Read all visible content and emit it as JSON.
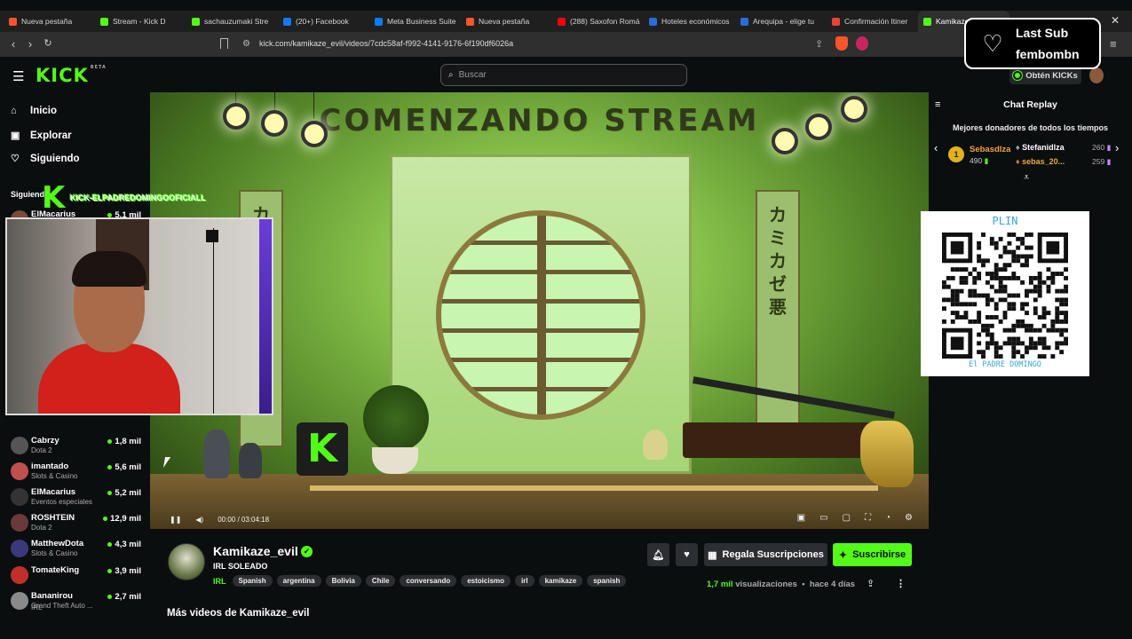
{
  "browser": {
    "tabs": [
      {
        "title": "Nueva pestaña",
        "color": "#fb542b"
      },
      {
        "title": "Stream - Kick D",
        "color": "#53fc18"
      },
      {
        "title": "sachauzumaki Stre",
        "color": "#53fc18"
      },
      {
        "title": "(20+) Facebook",
        "color": "#1877f2"
      },
      {
        "title": "Meta Business Suite",
        "color": "#0a7cff"
      },
      {
        "title": "Nueva pestaña",
        "color": "#fb542b"
      },
      {
        "title": "(288) Saxofon Romá",
        "color": "#ff0000"
      },
      {
        "title": "Hoteles económicos",
        "color": "#2a6dd9"
      },
      {
        "title": "Arequipa - elige tu",
        "color": "#2a6dd9"
      },
      {
        "title": "Confirmación Itiner",
        "color": "#ea4335"
      },
      {
        "title": "Kamikaze",
        "color": "#53fc18"
      }
    ],
    "url": "kick.com/kamikaze_evil/videos/7cdc58af-f992-4141-9176-6f190df6026a"
  },
  "header": {
    "logo": "KICK",
    "logo_badge": "BETA",
    "search_placeholder": "Buscar",
    "kicks_button": "Obtén KICKs"
  },
  "overlay": {
    "last_sub_label": "Last Sub",
    "last_sub_name": "fembombn",
    "webcam_name": "KICK-ELPADREDOMINGOOFICIALL"
  },
  "sidebar": {
    "nav": [
      {
        "label": "Inicio",
        "icon": "home-icon"
      },
      {
        "label": "Explorar",
        "icon": "compass-icon"
      },
      {
        "label": "Siguiendo",
        "icon": "heart-icon"
      }
    ],
    "section_title": "Siguiendo",
    "channels": [
      {
        "name": "ElMacarius",
        "category": "",
        "viewers": "5,1 mil"
      },
      {
        "name": "Cabrzy",
        "category": "Dota 2",
        "viewers": "1,8 mil"
      },
      {
        "name": "imantado",
        "category": "Slots & Casino",
        "viewers": "5,6 mil"
      },
      {
        "name": "ElMacarius",
        "category": "Eventos especiales",
        "viewers": "5,2 mil"
      },
      {
        "name": "ROSHTEIN",
        "category": "Dota 2",
        "viewers": "12,9 mil"
      },
      {
        "name": "MatthewDota",
        "category": "Slots & Casino",
        "viewers": "4,3 mil"
      },
      {
        "name": "TomateKing",
        "category": "",
        "viewers": "3,9 mil"
      },
      {
        "name": "Bananirou",
        "category": "Grand Theft Auto ...",
        "viewers": "2,7 mil"
      }
    ],
    "last_category": "IRL"
  },
  "video": {
    "scene_title": "COMENZANDO STREAM",
    "scroll_left": [
      "カ",
      "ミ",
      "カ",
      "ゼ",
      "悪"
    ],
    "scroll_right": [
      "カ",
      "ミ",
      "カ",
      "ゼ",
      "悪"
    ],
    "time": "00:00 / 03:04:18"
  },
  "chat": {
    "title": "Chat Replay",
    "donors_title": "Mejores donadores de todos los tiempos",
    "top_donor": {
      "rank": "1",
      "name": "Sebasdlza",
      "amount": "490"
    },
    "donors": [
      {
        "name": "Stefanidlza",
        "amount": "260",
        "color": "#ffffff"
      },
      {
        "name": "sebas_20...",
        "amount": "259",
        "color": "#f0a73b"
      }
    ],
    "qr_title": "PLIN",
    "qr_caption": "El PADRE DOMINGO"
  },
  "channel": {
    "name": "Kamikaze_evil",
    "stream_title": "IRL SOLEADO",
    "category": "IRL",
    "tags": [
      "Spanish",
      "argentina",
      "Bolivia",
      "Chile",
      "conversando",
      "estoicismo",
      "irl",
      "kamikaze",
      "spanish"
    ],
    "gift_label": "Regala Suscripciones",
    "subscribe_label": "Suscribirse",
    "views_count": "1,7 mil",
    "views_label": "visualizaciones",
    "ago": "hace 4 días",
    "more_videos": "Más videos de Kamikaze_evil"
  }
}
